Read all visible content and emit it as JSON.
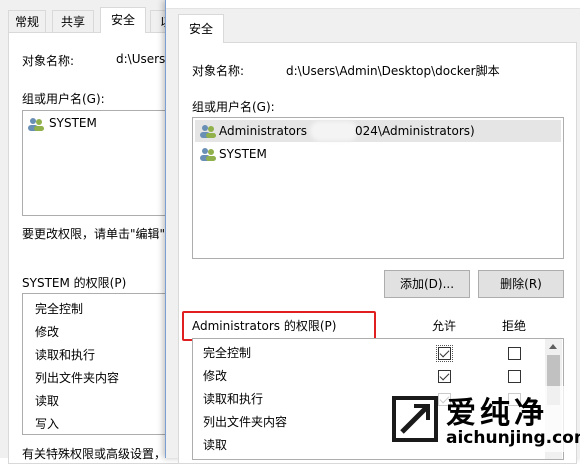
{
  "back_dialog": {
    "tabs": [
      "常规",
      "共享",
      "安全",
      "以"
    ],
    "object_label": "对象名称:",
    "object_value": "d:\\Users",
    "group_label": "组或用户名(G):",
    "users": [
      "SYSTEM"
    ],
    "edit_hint": "要更改权限，请单击\"编辑\"",
    "perm_label": "SYSTEM 的权限(P)",
    "perms": [
      "完全控制",
      "修改",
      "读取和执行",
      "列出文件夹内容",
      "读取",
      "写入"
    ],
    "special_hint": "有关特殊权限或高级设置，"
  },
  "front_dialog": {
    "tab": "安全",
    "object_label": "对象名称:",
    "object_value": "d:\\Users\\Admin\\Desktop\\docker脚本",
    "group_label": "组或用户名(G):",
    "users": [
      {
        "name": "Administrators",
        "suffix": "024\\Administrators)"
      },
      {
        "name": "SYSTEM",
        "suffix": ""
      }
    ],
    "add_button": "添加(D)...",
    "remove_button": "删除(R)",
    "perm_label": "Administrators 的权限(P)",
    "allow_header": "允许",
    "deny_header": "拒绝",
    "perms": [
      {
        "label": "完全控制",
        "allow": true,
        "deny": false
      },
      {
        "label": "修改",
        "allow": true,
        "deny": false
      },
      {
        "label": "读取和执行",
        "allow": true,
        "deny": false
      },
      {
        "label": "列出文件夹内容",
        "allow": false,
        "deny": false
      },
      {
        "label": "读取",
        "allow": false,
        "deny": false
      }
    ],
    "highlight_color": "#e02020"
  },
  "watermark": {
    "cn": "爱纯净",
    "url": "aichunjing.com",
    "color": "#1a1a1a"
  }
}
